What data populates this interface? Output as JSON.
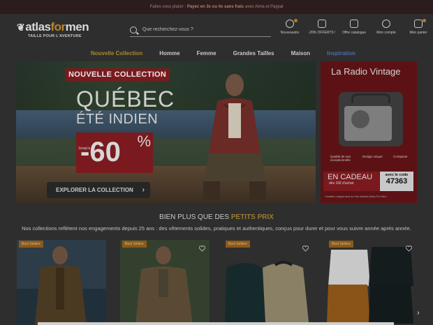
{
  "promo": {
    "prefix": "Faites vous plaisir :",
    "highlight": "Payez en 3x ou 4x sans frais",
    "suffix": "avec Alma et Paypal"
  },
  "logo": {
    "part1": "atlas",
    "part2": "for",
    "part3": "men",
    "tagline": "TAILLE POUR L'AVENTURE"
  },
  "search": {
    "placeholder": "Que recherchez-vous ?"
  },
  "header_actions": [
    {
      "label": "Nouveautés",
      "icon": "bell-icon"
    },
    {
      "label": "-20% OFFERTS !",
      "icon": "mail-icon"
    },
    {
      "label": "Offre catalogue",
      "icon": "catalog-icon"
    },
    {
      "label": "Mon compte",
      "icon": "user-icon"
    },
    {
      "label": "Mon panier",
      "icon": "cart-icon"
    }
  ],
  "nav": [
    "Nouvelle Collection",
    "Homme",
    "Femme",
    "Grandes Tailles",
    "Maison",
    "Inspiration"
  ],
  "hero": {
    "badge": "NOUVELLE COLLECTION",
    "title": "QUÉBEC",
    "subtitle": "ÉTÉ INDIEN",
    "upto": "Jusqu'à",
    "discount": "-60",
    "percent": "%",
    "cta": "EXPLORER LA COLLECTION"
  },
  "side_ad": {
    "title": "La Radio Vintage",
    "features": [
      "Qualité de son exceptionnelle",
      "Design unique",
      "Compacte"
    ],
    "gift_big": "EN CADEAU",
    "gift_small": "dès 15€ d'achat",
    "code_label": "avec le code",
    "code": "47363",
    "fine_print": "*valable uniquement sur les articles Atlas For Men"
  },
  "section": {
    "title_prefix": "BIEN PLUS QUE DES ",
    "title_highlight": "PETITS PRIX",
    "description": "Nos collections reflètent nos engagements depuis 25 ans : des vêtements solides, pratiques et authentiques, conçus pour durer et pour vous suivre année après année."
  },
  "products": [
    {
      "badge": "Best Sellers"
    },
    {
      "badge": "Best Sellers"
    },
    {
      "badge": "Best Sellers"
    },
    {
      "badge": "Best Sellers"
    }
  ],
  "colors": {
    "brand_gold": "#b8862c",
    "brand_red": "#7a1a1e",
    "badge_orange": "#8c5a1a",
    "inspiration_blue": "#4d6da6"
  }
}
